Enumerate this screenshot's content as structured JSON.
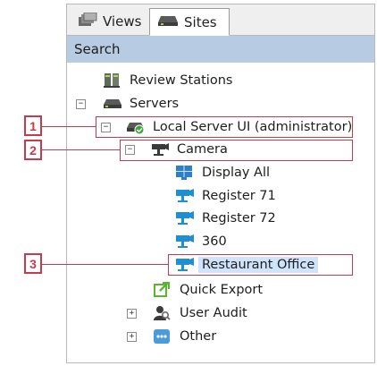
{
  "tabs": {
    "views": {
      "label": "Views",
      "icon": "views-icon"
    },
    "sites": {
      "label": "Sites",
      "icon": "server-icon",
      "active": true
    }
  },
  "search": {
    "label": "Search"
  },
  "tree": {
    "review_stations": "Review Stations",
    "servers": "Servers",
    "local_server": "Local Server UI (administrator)",
    "camera": "Camera",
    "display_all": "Display All",
    "register_71": "Register 71",
    "register_72": "Register 72",
    "cam_360": "360",
    "restaurant_office": "Restaurant Office",
    "quick_export": "Quick Export",
    "user_audit": "User Audit",
    "other": "Other"
  },
  "callouts": [
    "1",
    "2",
    "3"
  ],
  "colors": {
    "callout": "#c43b4b",
    "search_bar": "#b7cbe2",
    "selection": "#cfe3fa",
    "camera_blue": "#1e8fd6"
  }
}
